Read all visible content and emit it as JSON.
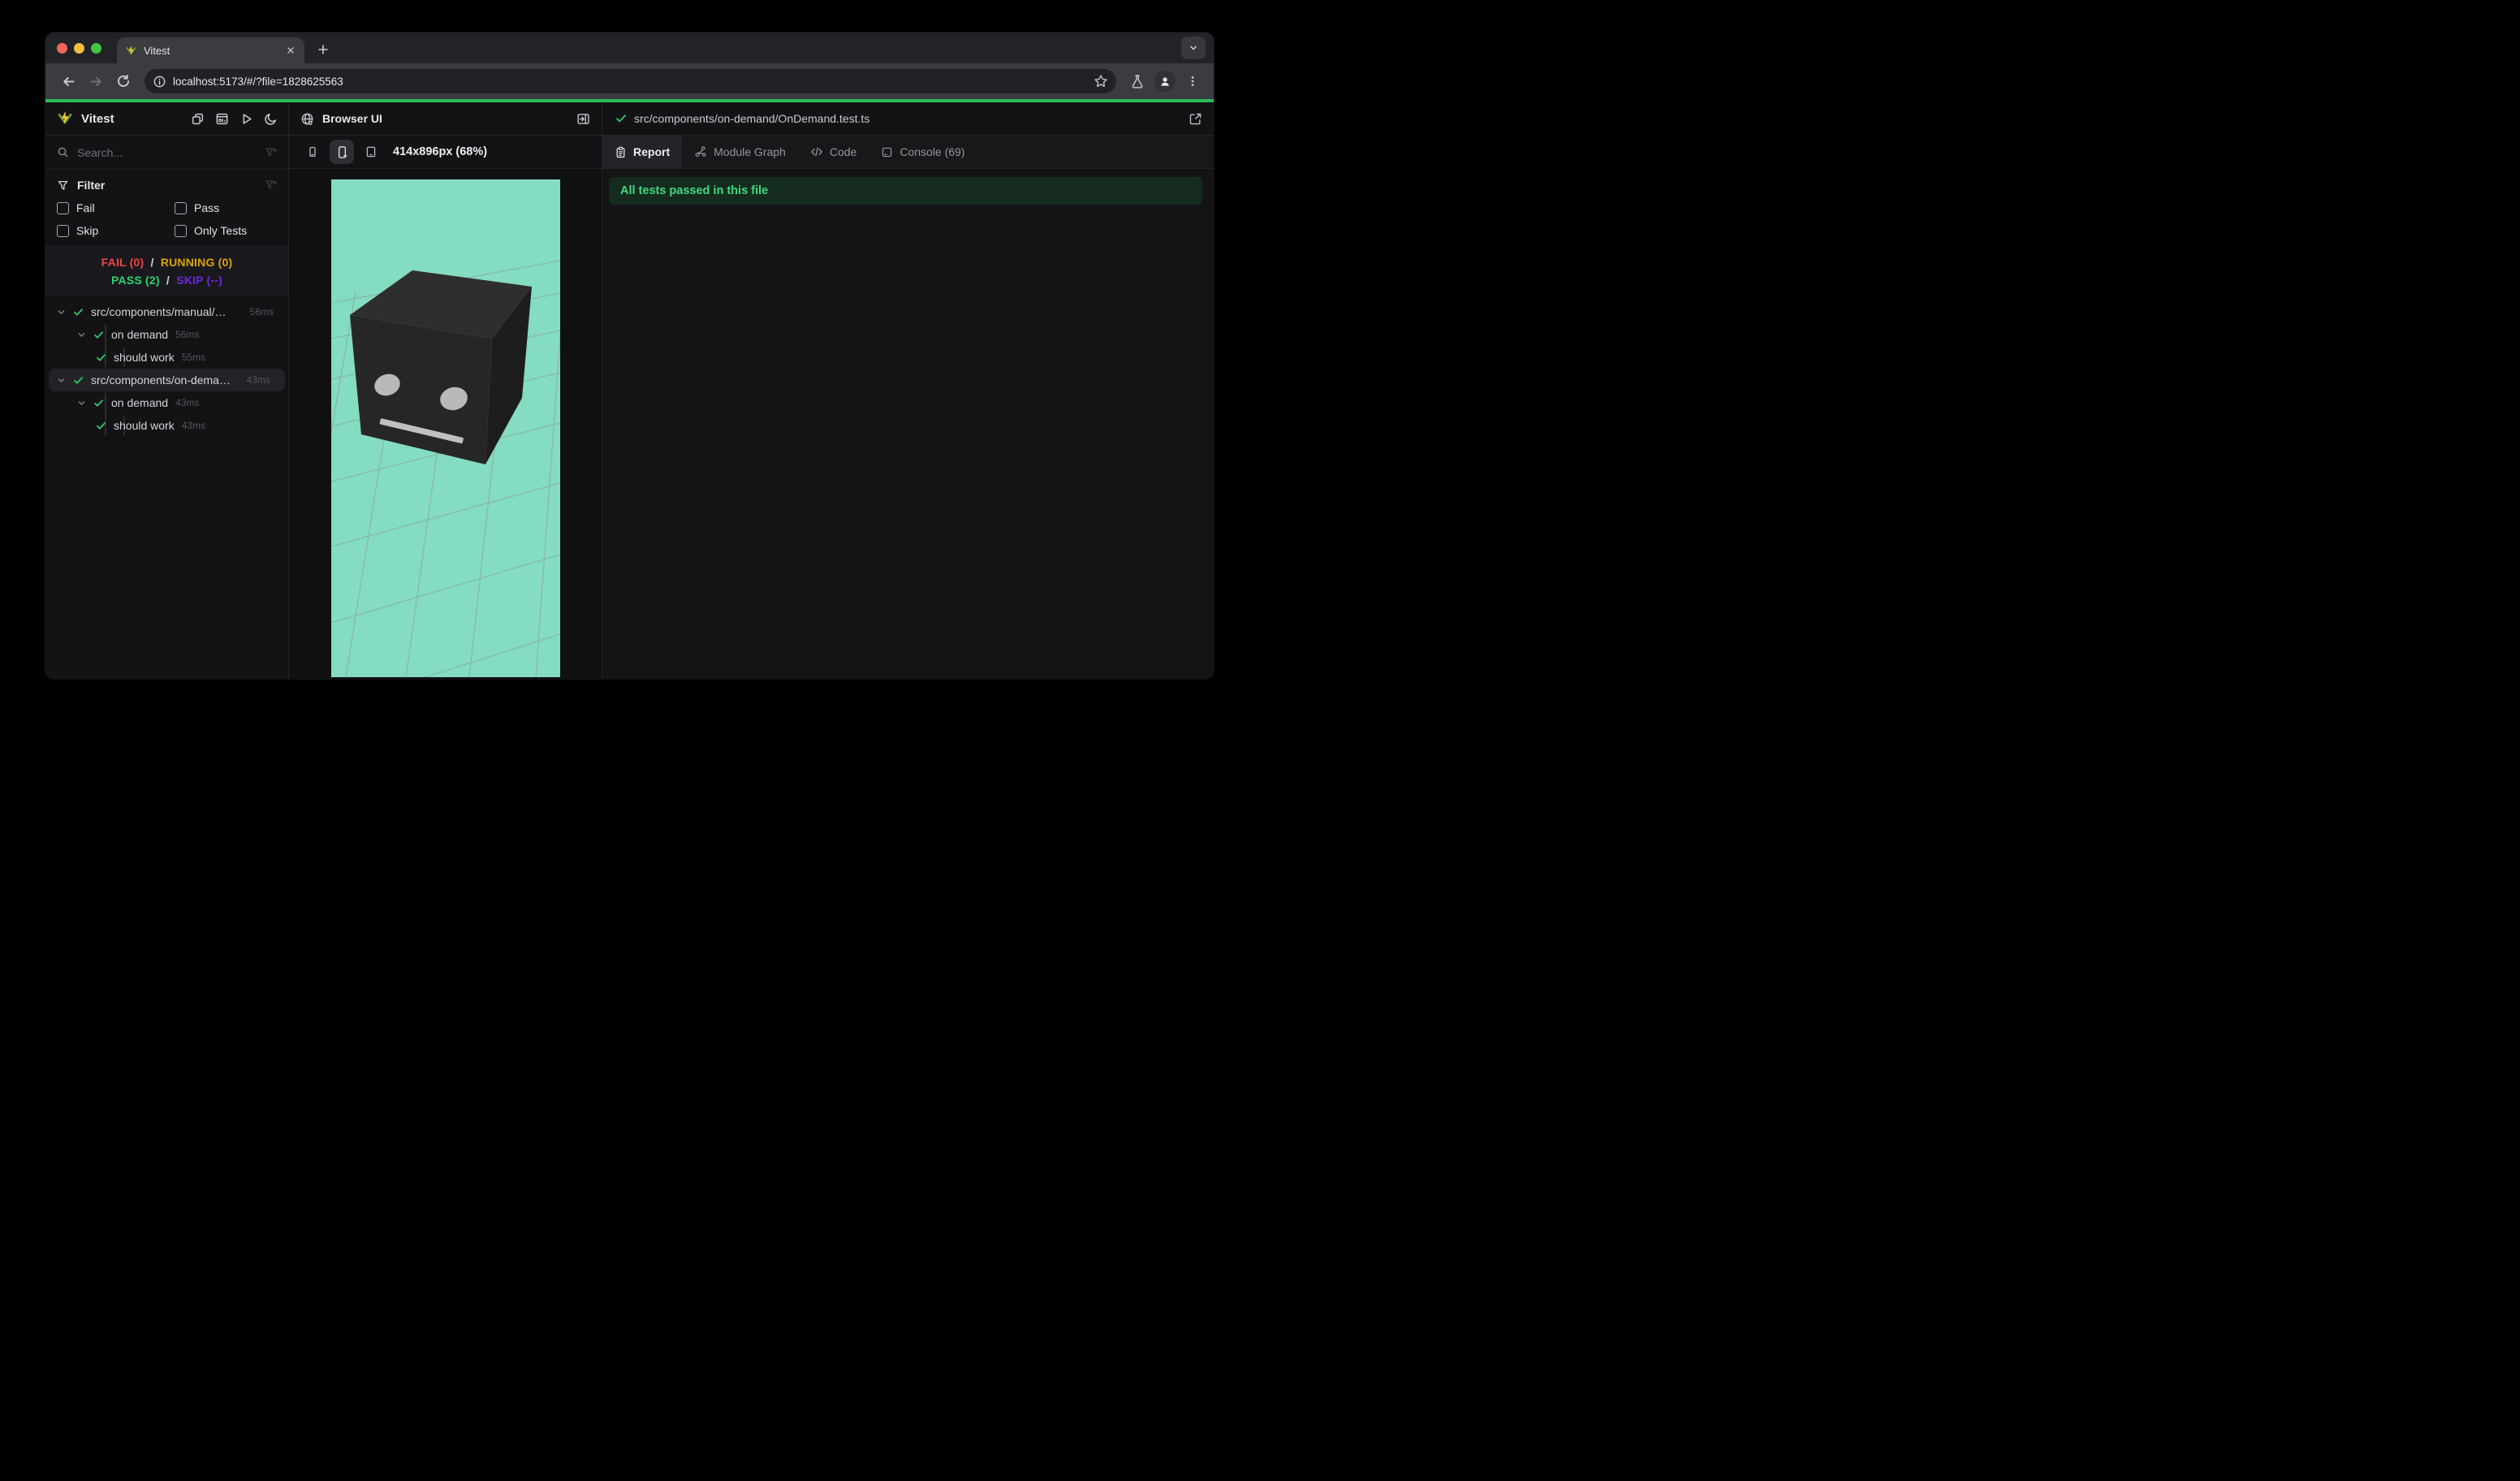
{
  "browser": {
    "tab_title": "Vitest",
    "url": "localhost:5173/#/?file=1828625563"
  },
  "colors": {
    "progress_bar": "#2dbd59",
    "pass": "#2bd46f",
    "fail": "#f04444",
    "running": "#d9a408",
    "skip": "#6d28d9",
    "banner_bg": "#152b1d",
    "banner_text": "#3fd97f",
    "viewport_bg": "#84dcc2",
    "cube_front": "#262626",
    "cube_top": "#2e2e2e"
  },
  "sidebar": {
    "app_title": "Vitest",
    "search_placeholder": "Search...",
    "filter": {
      "title": "Filter",
      "options": [
        "Fail",
        "Pass",
        "Skip",
        "Only Tests"
      ]
    },
    "summary": {
      "fail": "FAIL (0)",
      "running": "RUNNING (0)",
      "pass": "PASS (2)",
      "skip": "SKIP (--)",
      "separator": "/"
    },
    "tree": [
      {
        "label": "src/components/manual/…",
        "duration": "56ms",
        "level": 0,
        "chevron": true,
        "selected": false
      },
      {
        "label": "on demand",
        "duration": "56ms",
        "level": 1,
        "chevron": true,
        "selected": false
      },
      {
        "label": "should work",
        "duration": "55ms",
        "level": 2,
        "chevron": false,
        "selected": false
      },
      {
        "label": "src/components/on-dema…",
        "duration": "43ms",
        "level": 0,
        "chevron": true,
        "selected": true
      },
      {
        "label": "on demand",
        "duration": "43ms",
        "level": 1,
        "chevron": true,
        "selected": false
      },
      {
        "label": "should work",
        "duration": "43ms",
        "level": 2,
        "chevron": false,
        "selected": false
      }
    ]
  },
  "preview": {
    "title": "Browser UI",
    "viewport_label": "414x896px (68%)"
  },
  "results": {
    "file_path": "src/components/on-demand/OnDemand.test.ts",
    "tabs": [
      "Report",
      "Module Graph",
      "Code",
      "Console (69)"
    ],
    "active_tab": "Report",
    "banner": "All tests passed in this file"
  }
}
